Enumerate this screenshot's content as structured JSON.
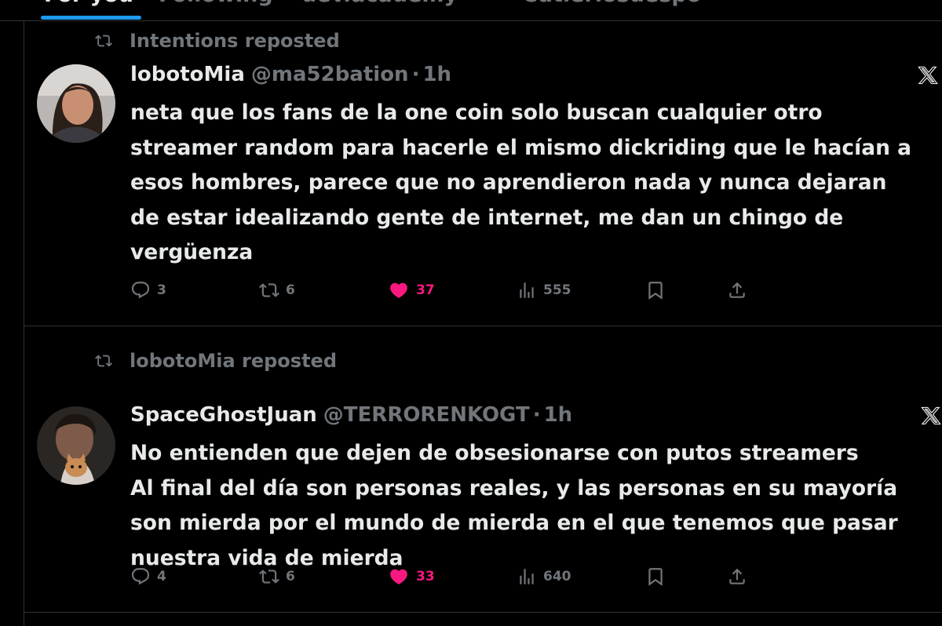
{
  "tabs": [
    {
      "label": "For you",
      "active": true
    },
    {
      "label": "Following",
      "active": false
    },
    {
      "label": "dev.academy",
      "active": false
    },
    {
      "label": "Cutlerlosdespo",
      "active": false
    }
  ],
  "colors": {
    "background": "#000000",
    "text_primary": "#e7e9ea",
    "text_secondary": "#71767b",
    "like_active": "#f91880",
    "divider": "#2f3336",
    "accent": "#1d9bf0"
  },
  "tweets": [
    {
      "repost_label": "Intentions reposted",
      "display_name": "lobotoMia",
      "handle": "@ma52bation",
      "time": "1h",
      "text": "neta que los fans de la one coin solo buscan cualquier otro\nstreamer random para hacerle el mismo dickriding que le hacían a\nesos hombres, parece que no aprendieron nada y nunca dejaran\nde estar idealizando gente de internet, me dan un chingo de\nvergüenza",
      "replies": "3",
      "reposts": "6",
      "likes": "37",
      "views": "555",
      "liked": true,
      "icons": [
        "repost-icon",
        "x-logo-icon",
        "reply-icon",
        "repost-icon",
        "heart-icon",
        "views-icon",
        "bookmark-icon",
        "share-icon"
      ]
    },
    {
      "repost_label": "lobotoMia reposted",
      "display_name": "SpaceGhostJuan",
      "handle": "@TERRORENKOGT",
      "time": "1h",
      "text": "No entienden que dejen de obsesionarse con putos streamers\nAl final del día son personas reales, y las personas en su mayoría\nson mierda por el mundo de mierda en el que tenemos que pasar\nnuestra vida de mierda",
      "replies": "4",
      "reposts": "6",
      "likes": "33",
      "views": "640",
      "liked": true,
      "icons": [
        "repost-icon",
        "x-logo-icon",
        "reply-icon",
        "repost-icon",
        "heart-icon",
        "views-icon",
        "bookmark-icon",
        "share-icon"
      ]
    }
  ]
}
